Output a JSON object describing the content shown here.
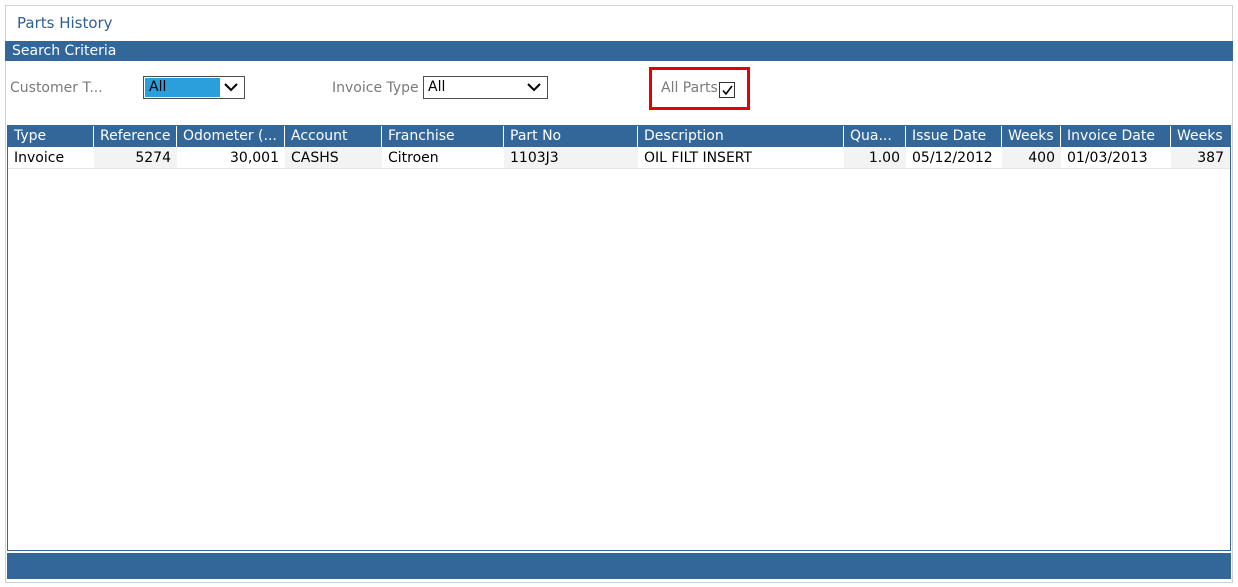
{
  "page": {
    "title": "Parts History",
    "section_title": "Search Criteria"
  },
  "criteria": {
    "customer_type_label": "Customer T...",
    "customer_type_value": "All",
    "invoice_type_label": "Invoice Type",
    "invoice_type_value": "All",
    "all_parts_label": "All Parts",
    "all_parts_checked": true
  },
  "table": {
    "columns": [
      "Type",
      "Reference",
      "Odometer (...",
      "Account",
      "Franchise",
      "Part No",
      "Description",
      "Qua...",
      "Issue Date",
      "Weeks",
      "Invoice Date",
      "Weeks"
    ],
    "rows": [
      [
        "Invoice",
        "5274",
        "30,001",
        "CASHS",
        "Citroen",
        "1103J3",
        "OIL FILT INSERT",
        "1.00",
        "05/12/2012",
        "400",
        "01/03/2013",
        "387"
      ]
    ]
  },
  "colors": {
    "header_bg": "#336699",
    "highlight": "#e60000",
    "selection": "#2b9fdc"
  }
}
